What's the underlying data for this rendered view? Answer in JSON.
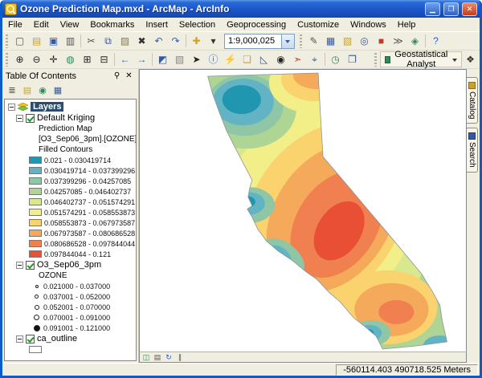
{
  "window": {
    "title": "Ozone Prediction Map.mxd - ArcMap - ArcInfo",
    "minimize": "▁",
    "maximize": "❐",
    "close": "✕"
  },
  "menubar": [
    "File",
    "Edit",
    "View",
    "Bookmarks",
    "Insert",
    "Selection",
    "Geoprocessing",
    "Customize",
    "Windows",
    "Help"
  ],
  "toolbars": {
    "scale": "1:9,000,025",
    "ga_label": "Geostatistical Analyst",
    "ga_tool_glyph": "❖",
    "standard_left": [
      {
        "name": "new-map-button",
        "glyph": "▢",
        "color": "#555555"
      },
      {
        "name": "open-button",
        "glyph": "▤",
        "color": "#C9A227"
      },
      {
        "name": "save-button",
        "glyph": "▣",
        "color": "#35589E"
      },
      {
        "name": "print-button",
        "glyph": "▥",
        "color": "#555555"
      },
      {
        "sep": true
      },
      {
        "name": "cut-button",
        "glyph": "✂",
        "color": "#555555"
      },
      {
        "name": "copy-button",
        "glyph": "⧉",
        "color": "#35589E"
      },
      {
        "name": "paste-button",
        "glyph": "▨",
        "color": "#8A7A4A"
      },
      {
        "name": "delete-button",
        "glyph": "✖",
        "color": "#333333"
      },
      {
        "name": "undo-button",
        "glyph": "↶",
        "color": "#2B5FC0"
      },
      {
        "name": "redo-button",
        "glyph": "↷",
        "color": "#2B5FC0"
      },
      {
        "sep": true
      },
      {
        "name": "add-data-button",
        "glyph": "✚",
        "color": "#D99F1B"
      },
      {
        "name": "add-data-dropdown-button",
        "glyph": "▾",
        "color": "#333333"
      }
    ],
    "standard_right": [
      {
        "name": "editor-toolbar-button",
        "glyph": "✎",
        "color": "#555555"
      },
      {
        "name": "table-of-contents-button",
        "glyph": "▦",
        "color": "#35589E"
      },
      {
        "name": "catalog-window-button",
        "glyph": "▧",
        "color": "#C9A227"
      },
      {
        "name": "search-window-button",
        "glyph": "◎",
        "color": "#35589E"
      },
      {
        "name": "arctoolbox-button",
        "glyph": "■",
        "color": "#C0392B"
      },
      {
        "name": "python-window-button",
        "glyph": "≫",
        "color": "#555555"
      },
      {
        "name": "model-builder-button",
        "glyph": "◈",
        "color": "#2E8B57"
      },
      {
        "sep": true
      },
      {
        "name": "help-button",
        "glyph": "?",
        "color": "#2B5FC0"
      }
    ],
    "tools": [
      {
        "name": "zoom-in-tool",
        "glyph": "⊕",
        "color": "#222222"
      },
      {
        "name": "zoom-out-tool",
        "glyph": "⊖",
        "color": "#222222"
      },
      {
        "name": "pan-tool",
        "glyph": "✛",
        "color": "#222222"
      },
      {
        "name": "full-extent-button",
        "glyph": "◍",
        "color": "#2E8B57"
      },
      {
        "name": "fixed-zoom-in-button",
        "glyph": "⊞",
        "color": "#222222"
      },
      {
        "name": "fixed-zoom-out-button",
        "glyph": "⊟",
        "color": "#222222"
      },
      {
        "sep": true
      },
      {
        "name": "back-extent-button",
        "glyph": "←",
        "color": "#2B5FC0"
      },
      {
        "name": "forward-extent-button",
        "glyph": "→",
        "color": "#2B5FC0"
      },
      {
        "sep": true
      },
      {
        "name": "select-features-tool",
        "glyph": "◩",
        "color": "#35589E"
      },
      {
        "name": "clear-selection-button",
        "glyph": "▧",
        "color": "#888888"
      },
      {
        "name": "select-elements-tool",
        "glyph": "➤",
        "color": "#222222"
      },
      {
        "name": "identify-tool",
        "glyph": "ⓘ",
        "color": "#2B5FC0"
      },
      {
        "name": "hyperlink-tool",
        "glyph": "⚡",
        "color": "#D7A800"
      },
      {
        "name": "html-popup-tool",
        "glyph": "❑",
        "color": "#C9A227"
      },
      {
        "name": "measure-tool",
        "glyph": "◺",
        "color": "#35589E"
      },
      {
        "name": "find-button",
        "glyph": "◉",
        "color": "#222222"
      },
      {
        "name": "find-route-button",
        "glyph": "➣",
        "color": "#C0392B"
      },
      {
        "name": "go-to-xy-button",
        "glyph": "⌖",
        "color": "#35589E"
      },
      {
        "sep": true
      },
      {
        "name": "time-slider-button",
        "glyph": "◷",
        "color": "#2E8B57"
      },
      {
        "name": "viewer-window-button",
        "glyph": "❐",
        "color": "#35589E"
      }
    ]
  },
  "toc": {
    "title": "Table Of Contents",
    "pin_glyph": "⚲",
    "close_glyph": "✕",
    "toolbar": [
      {
        "name": "list-by-drawing-order-button",
        "glyph": "≣",
        "color": "#35589E"
      },
      {
        "name": "list-by-source-button",
        "glyph": "▤",
        "color": "#C9A227"
      },
      {
        "name": "list-by-visibility-button",
        "glyph": "◉",
        "color": "#2E8B57"
      },
      {
        "name": "list-by-selection-button",
        "glyph": "▦",
        "color": "#35589E"
      }
    ],
    "layers_label": "Layers",
    "kriging_label": "Default Kriging",
    "kriging_sub1": "Prediction Map",
    "kriging_sub2": "[O3_Sep06_3pm].[OZONE]",
    "kriging_sub3": "Filled Contours",
    "kriging_classes": [
      {
        "color": "#2196B0",
        "label": "0.021 - 0.030419714"
      },
      {
        "color": "#62B4C4",
        "label": "0.030419714 - 0.037399296"
      },
      {
        "color": "#8EC6A6",
        "label": "0.037399296 - 0.04257085"
      },
      {
        "color": "#AED594",
        "label": "0.04257085 - 0.046402737"
      },
      {
        "color": "#D7E88E",
        "label": "0.046402737 - 0.051574291"
      },
      {
        "color": "#F2EF88",
        "label": "0.051574291 - 0.058553873"
      },
      {
        "color": "#FAD36F",
        "label": "0.058553873 - 0.067973587"
      },
      {
        "color": "#F4A95B",
        "label": "0.067973587 - 0.080686528"
      },
      {
        "color": "#F08050",
        "label": "0.080686528 - 0.097844044"
      },
      {
        "color": "#E94F35",
        "label": "0.097844044 - 0.121"
      }
    ],
    "points_label": "O3_Sep06_3pm",
    "points_field": "OZONE",
    "point_classes": [
      {
        "size": 4,
        "filled": false,
        "label": "0.021000 - 0.037000"
      },
      {
        "size": 5,
        "filled": false,
        "label": "0.037001 - 0.052000"
      },
      {
        "size": 6,
        "filled": false,
        "label": "0.052001 - 0.070000"
      },
      {
        "size": 7,
        "filled": false,
        "label": "0.070001 - 0.091000"
      },
      {
        "size": 8,
        "filled": true,
        "label": "0.091001 - 0.121000"
      }
    ],
    "outline_label": "ca_outline"
  },
  "side_tabs": [
    {
      "label": "Catalog",
      "name": "tab-catalog",
      "color": "#C9A227"
    },
    {
      "label": "Search",
      "name": "tab-search",
      "color": "#35589E"
    }
  ],
  "view_buttons": [
    {
      "name": "data-view-button",
      "glyph": "◫",
      "color": "#2E8B57"
    },
    {
      "name": "layout-view-button",
      "glyph": "▤",
      "color": "#555555"
    },
    {
      "name": "refresh-view-button",
      "glyph": "↻",
      "color": "#2B5FC0"
    },
    {
      "name": "pause-drawing-button",
      "glyph": "∥",
      "color": "#555555"
    }
  ],
  "statusbar": {
    "coordinates": "-560114.403  490718.525 Meters"
  }
}
